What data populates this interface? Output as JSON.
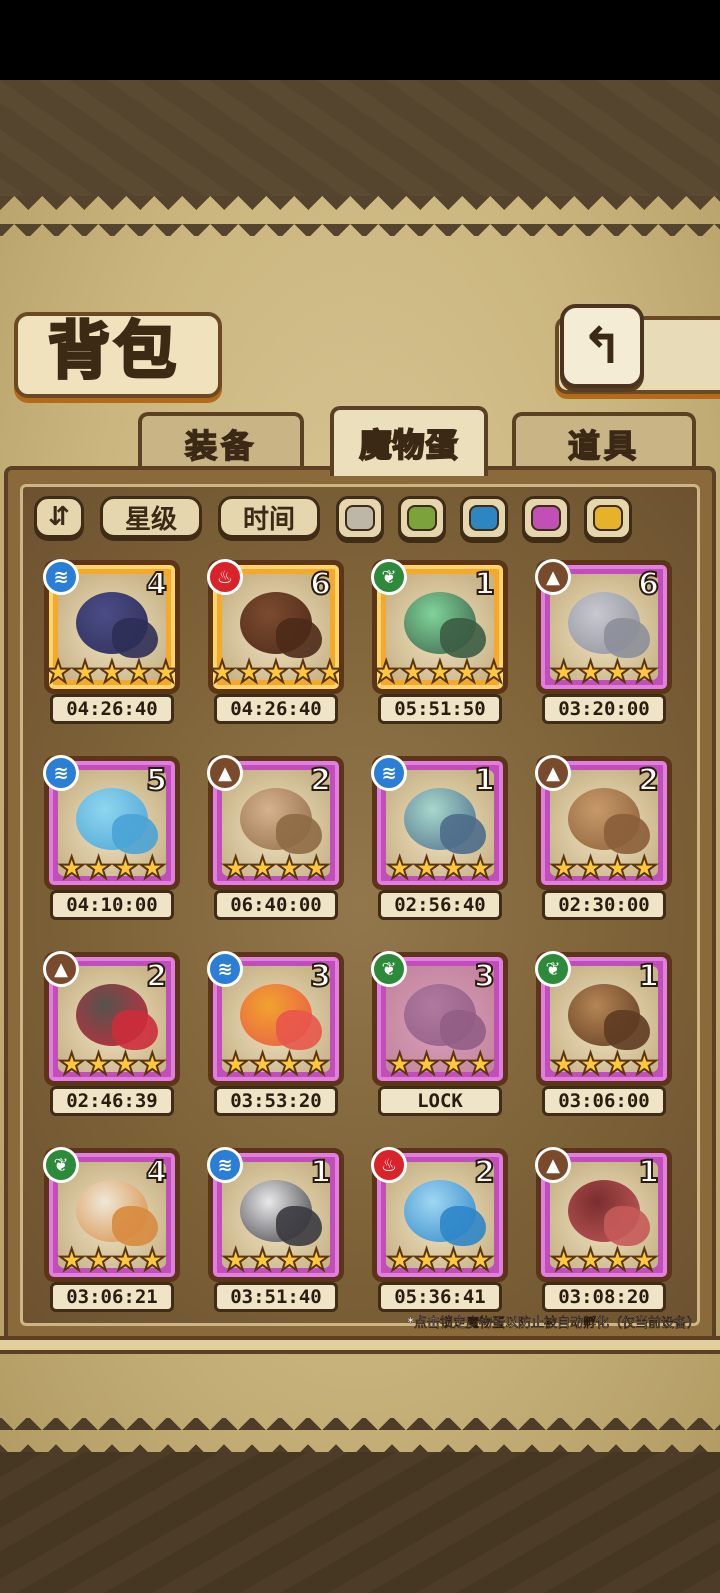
{
  "header": {
    "title": "背包",
    "back_icon": "↰"
  },
  "tabs": [
    {
      "label": "装备",
      "active": false
    },
    {
      "label": "魔物蛋",
      "active": true
    },
    {
      "label": "道具",
      "active": false
    }
  ],
  "filters": {
    "sort_toggle_icon": "⇵",
    "star_label": "星级",
    "time_label": "时间",
    "swatches": [
      "#bdb7a7",
      "#7aa33a",
      "#2b86c2",
      "#c24fb6",
      "#e5b22a"
    ]
  },
  "eggs": [
    {
      "element": "water",
      "count": "4",
      "stars": "★★★★★",
      "timer": "04:26:40",
      "rarity": "gold",
      "c1": "#4b4c86",
      "c2": "#2e2f57"
    },
    {
      "element": "fire",
      "count": "6",
      "stars": "★★★★★",
      "timer": "04:26:40",
      "rarity": "gold",
      "c1": "#7b4b2f",
      "c2": "#4d2a18"
    },
    {
      "element": "grass",
      "count": "1",
      "stars": "★★★★★",
      "timer": "05:51:50",
      "rarity": "gold",
      "c1": "#7fd49a",
      "c2": "#3b5d44"
    },
    {
      "element": "earth",
      "count": "6",
      "stars": "★★★★",
      "timer": "03:20:00",
      "rarity": "purple",
      "c1": "#c8c9cf",
      "c2": "#8c8f99"
    },
    {
      "element": "water",
      "count": "5",
      "stars": "★★★★",
      "timer": "04:10:00",
      "rarity": "purple",
      "c1": "#8fd6ee",
      "c2": "#4aa3d6"
    },
    {
      "element": "earth",
      "count": "2",
      "stars": "★★★★",
      "timer": "06:40:00",
      "rarity": "purple",
      "c1": "#d7b28f",
      "c2": "#8e6a45"
    },
    {
      "element": "water",
      "count": "1",
      "stars": "★★★★",
      "timer": "02:56:40",
      "rarity": "purple",
      "c1": "#a7d8cc",
      "c2": "#4d6b8a"
    },
    {
      "element": "earth",
      "count": "2",
      "stars": "★★★★",
      "timer": "02:30:00",
      "rarity": "purple",
      "c1": "#c89a6a",
      "c2": "#8a5e38"
    },
    {
      "element": "earth",
      "count": "2",
      "stars": "★★★★",
      "timer": "02:46:39",
      "rarity": "purple",
      "c1": "#55534e",
      "c2": "#cc2c3b"
    },
    {
      "element": "water",
      "count": "3",
      "stars": "★★★★",
      "timer": "03:53:20",
      "rarity": "purple",
      "c1": "#f1a32e",
      "c2": "#e8574a"
    },
    {
      "element": "grass",
      "count": "3",
      "stars": "★★★★",
      "timer": "LOCK",
      "rarity": "purple",
      "c1": "#a39d8a",
      "c2": "#6e6a5c"
    },
    {
      "element": "grass",
      "count": "1",
      "stars": "★★★★",
      "timer": "03:06:00",
      "rarity": "purple",
      "c1": "#b58554",
      "c2": "#5e3b22"
    },
    {
      "element": "grass",
      "count": "4",
      "stars": "★★★★",
      "timer": "03:06:21",
      "rarity": "purple",
      "c1": "#efe7d8",
      "c2": "#d78b3e"
    },
    {
      "element": "water",
      "count": "1",
      "stars": "★★★★",
      "timer": "03:51:40",
      "rarity": "purple",
      "c1": "#e9e9ea",
      "c2": "#3b3a40"
    },
    {
      "element": "fire",
      "count": "2",
      "stars": "★★★★",
      "timer": "05:36:41",
      "rarity": "purple",
      "c1": "#9fd7f2",
      "c2": "#2f86c8"
    },
    {
      "element": "earth",
      "count": "1",
      "stars": "★★★★",
      "timer": "03:08:20",
      "rarity": "purple",
      "c1": "#7a2e2e",
      "c2": "#c55a5a"
    }
  ],
  "element_glyphs": {
    "water": "≋",
    "fire": "♨",
    "grass": "❦",
    "earth": "▲"
  },
  "footnote": "*点击锁定魔物蛋以防止被自动孵化（仅当前设备）"
}
